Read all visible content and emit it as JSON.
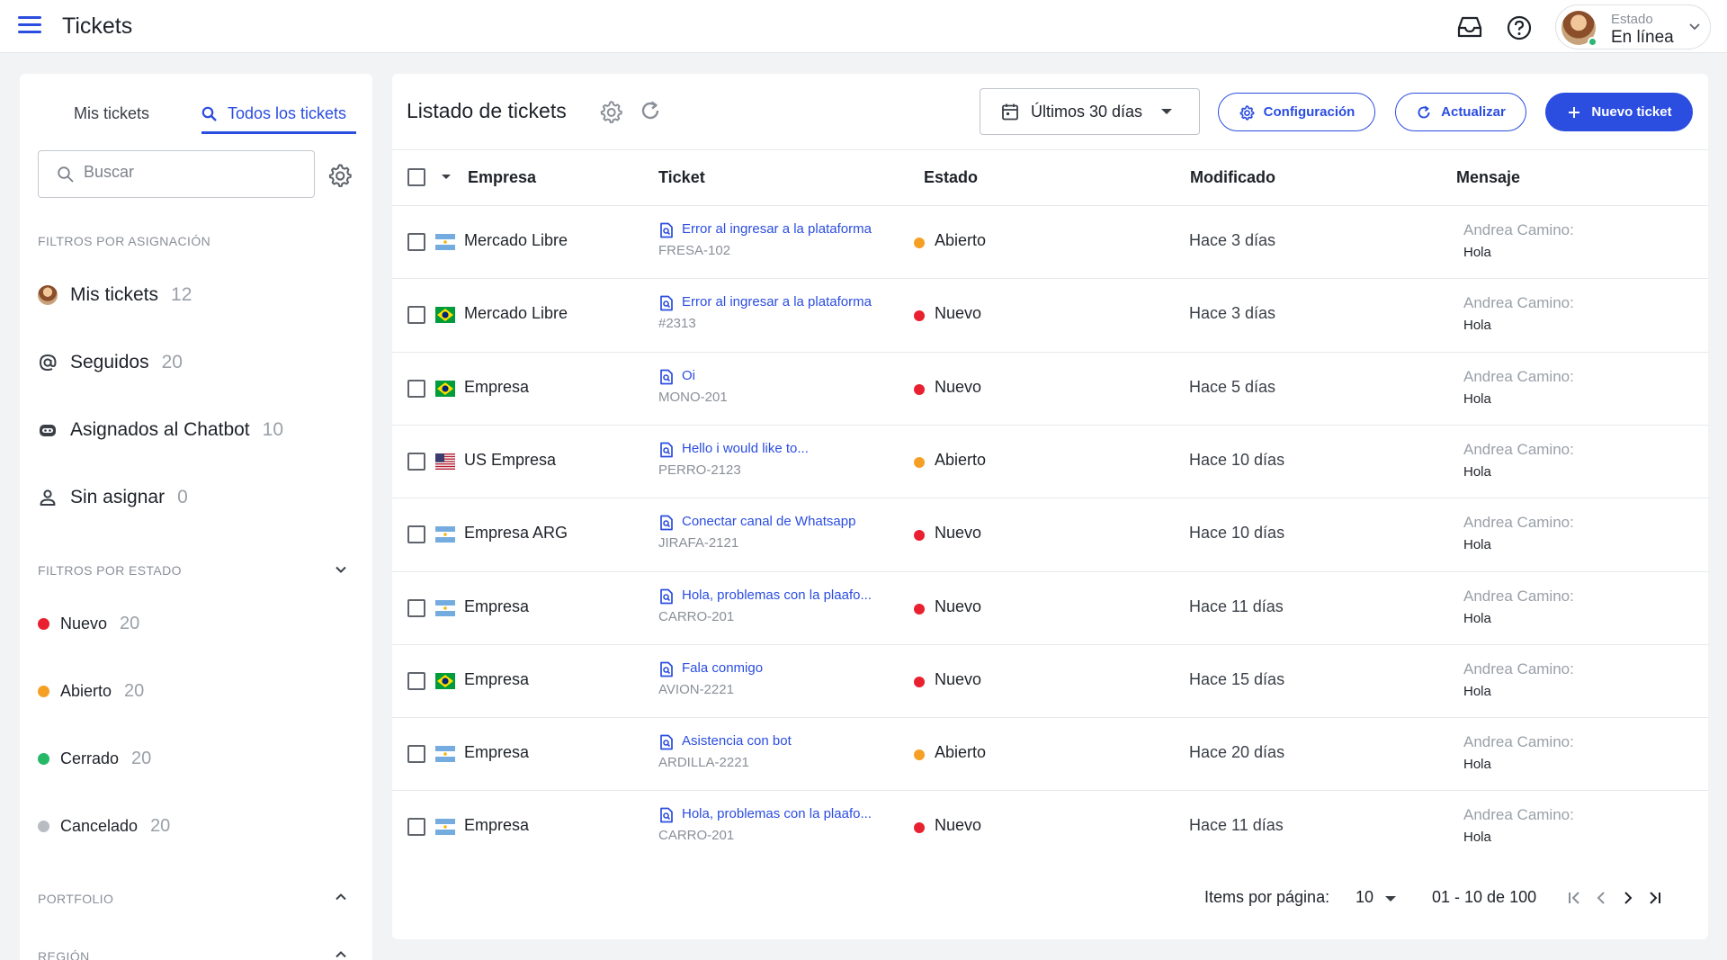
{
  "topbar": {
    "title": "Tickets",
    "status_caption": "Estado",
    "status_value": "En línea"
  },
  "sidebar": {
    "tabs": [
      {
        "label": "Mis tickets"
      },
      {
        "label": "Todos los tickets"
      }
    ],
    "search_placeholder": "Buscar",
    "assignment_section": "FILTROS POR ASIGNACIÓN",
    "assignment_items": [
      {
        "label": "Mis tickets",
        "count": "12",
        "icon": "avatar-icon"
      },
      {
        "label": "Seguidos",
        "count": "20",
        "icon": "at-icon"
      },
      {
        "label": "Asignados al Chatbot",
        "count": "10",
        "icon": "bot-icon"
      },
      {
        "label": "Sin asignar",
        "count": "0",
        "icon": "person-icon"
      }
    ],
    "state_section": "FILTROS POR ESTADO",
    "state_items": [
      {
        "label": "Nuevo",
        "count": "20",
        "color": "#e8202f"
      },
      {
        "label": "Abierto",
        "count": "20",
        "color": "#f5a025"
      },
      {
        "label": "Cerrado",
        "count": "20",
        "color": "#25b867"
      },
      {
        "label": "Cancelado",
        "count": "20",
        "color": "#b8bcc2"
      }
    ],
    "portfolio_section": "PORTFOLIO",
    "region_section": "REGIÓN"
  },
  "main": {
    "title": "Listado de tickets",
    "date_range": "Últimos 30 días",
    "config_label": "Configuración",
    "refresh_label": "Actualizar",
    "new_label": "Nuevo ticket",
    "columns": [
      "Empresa",
      "Ticket",
      "Estado",
      "Modificado",
      "Mensaje"
    ],
    "rows": [
      {
        "flag": "ar",
        "company": "Mercado Libre",
        "title": "Error al ingresar a la plataforma",
        "code": "FRESA-102",
        "status": "Abierto",
        "status_color": "#f5a025",
        "modified": "Hace 3 días",
        "author": "Andrea Camino:",
        "message": "Hola"
      },
      {
        "flag": "br",
        "company": "Mercado Libre",
        "title": "Error al ingresar a la plataforma",
        "code": "#2313",
        "status": "Nuevo",
        "status_color": "#e8202f",
        "modified": "Hace 3 días",
        "author": "Andrea Camino:",
        "message": "Hola"
      },
      {
        "flag": "br",
        "company": "Empresa",
        "title": "Oi",
        "code": "MONO-201",
        "status": "Nuevo",
        "status_color": "#e8202f",
        "modified": "Hace 5 días",
        "author": "Andrea Camino:",
        "message": "Hola"
      },
      {
        "flag": "us",
        "company": "US Empresa",
        "title": "Hello i would like to...",
        "code": "PERRO-2123",
        "status": "Abierto",
        "status_color": "#f5a025",
        "modified": "Hace 10 días",
        "author": "Andrea Camino:",
        "message": "Hola"
      },
      {
        "flag": "ar",
        "company": "Empresa ARG",
        "title": "Conectar canal de Whatsapp",
        "code": "JIRAFA-2121",
        "status": "Nuevo",
        "status_color": "#e8202f",
        "modified": "Hace 10 días",
        "author": "Andrea Camino:",
        "message": "Hola"
      },
      {
        "flag": "ar",
        "company": "Empresa",
        "title": "Hola, problemas con la plaafo...",
        "code": "CARRO-201",
        "status": "Nuevo",
        "status_color": "#e8202f",
        "modified": "Hace 11 días",
        "author": "Andrea Camino:",
        "message": "Hola"
      },
      {
        "flag": "br",
        "company": "Empresa",
        "title": "Fala conmigo",
        "code": "AVION-2221",
        "status": "Nuevo",
        "status_color": "#e8202f",
        "modified": "Hace 15 días",
        "author": "Andrea Camino:",
        "message": "Hola"
      },
      {
        "flag": "ar",
        "company": "Empresa",
        "title": "Asistencia con bot",
        "code": "ARDILLA-2221",
        "status": "Abierto",
        "status_color": "#f5a025",
        "modified": "Hace 20 días",
        "author": "Andrea Camino:",
        "message": "Hola"
      },
      {
        "flag": "ar",
        "company": "Empresa",
        "title": "Hola, problemas con la plaafo...",
        "code": "CARRO-201",
        "status": "Nuevo",
        "status_color": "#e8202f",
        "modified": "Hace 11 días",
        "author": "Andrea Camino:",
        "message": "Hola"
      }
    ],
    "pager": {
      "items_label": "Items por página:",
      "page_size": "10",
      "range": "01 - 10 de 100"
    }
  }
}
